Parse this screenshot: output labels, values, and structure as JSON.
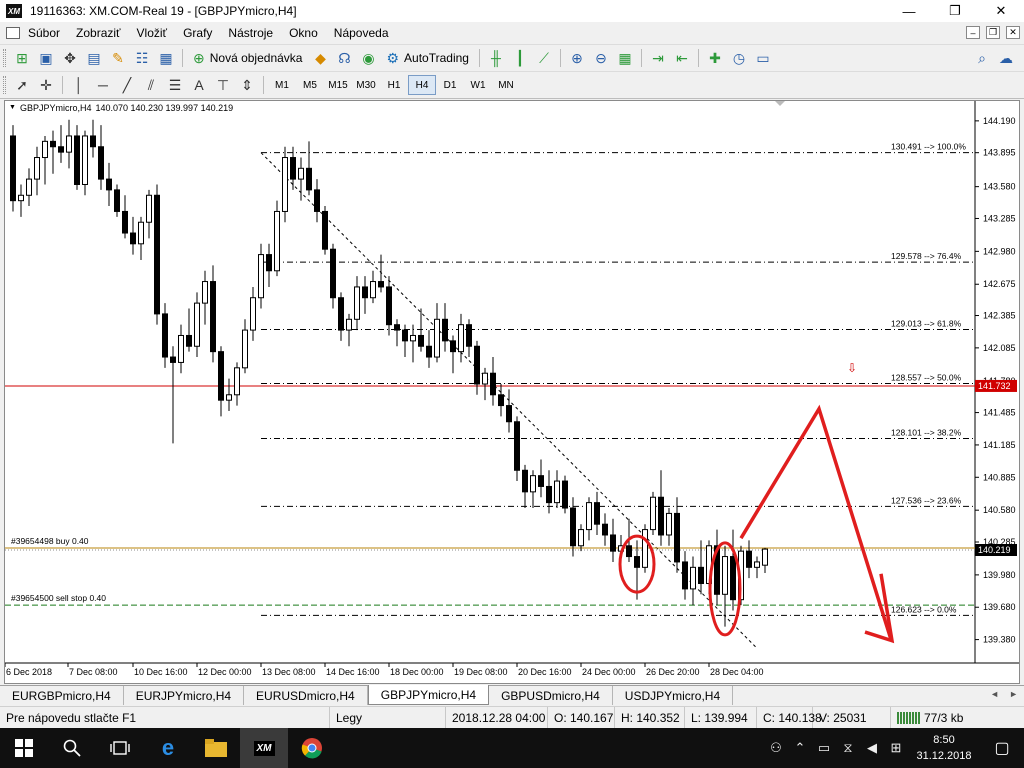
{
  "window": {
    "title": "19116363: XM.COM-Real 19 - [GBPJPYmicro,H4]",
    "app_icon_text": "XM",
    "minimize": "—",
    "maximize": "❐",
    "close": "✕"
  },
  "menu": {
    "items": [
      "Súbor",
      "Zobraziť",
      "Vložiť",
      "Grafy",
      "Nástroje",
      "Okno",
      "Nápoveda"
    ],
    "mdi_minimize": "–",
    "mdi_restore": "❐",
    "mdi_close": "✕"
  },
  "toolbar": {
    "new_order_label": "Nová objednávka",
    "autotrading_label": "AutoTrading"
  },
  "timeframes": [
    "M1",
    "M5",
    "M15",
    "M30",
    "H1",
    "H4",
    "D1",
    "W1",
    "MN"
  ],
  "active_timeframe": "H4",
  "chart": {
    "header_symbol": "GBPJPYmicro,H4",
    "header_ohlc": "140.070 140.230 139.997 140.219",
    "current_price": "140.219",
    "hline_price_tag": "141.732",
    "buy_order_label": "#39654498 buy 0.40",
    "sell_stop_label": "#39654500 sell stop 0.40",
    "colors": {
      "buy_line": "#b8860b",
      "sell_line": "#1a7a1a",
      "red_line": "#d00000",
      "annotation": "#e01e1e",
      "candle": "#000000"
    }
  },
  "chart_data": {
    "type": "candlestick",
    "title": "GBPJPYmicro,H4",
    "ylim": [
      139.2,
      144.3
    ],
    "y_ticks": [
      "144.190",
      "143.895",
      "143.580",
      "143.285",
      "142.980",
      "142.675",
      "142.385",
      "142.085",
      "141.780",
      "141.485",
      "141.185",
      "140.885",
      "140.580",
      "140.285",
      "139.980",
      "139.680",
      "139.380"
    ],
    "x_ticks": [
      "6 Dec 2018",
      "7 Dec 08:00",
      "10 Dec 16:00",
      "12 Dec 00:00",
      "13 Dec 08:00",
      "14 Dec 16:00",
      "18 Dec 00:00",
      "19 Dec 08:00",
      "20 Dec 16:00",
      "24 Dec 00:00",
      "26 Dec 20:00",
      "28 Dec 04:00"
    ],
    "fibonacci": [
      {
        "label": "130.491 --> 100.0%",
        "y": 143.895
      },
      {
        "label": "129.578 --> 76.4%",
        "y": 142.88
      },
      {
        "label": "129.013 --> 61.8%",
        "y": 142.255
      },
      {
        "label": "128.557 --> 50.0%",
        "y": 141.755
      },
      {
        "label": "128.101 --> 38.2%",
        "y": 141.245
      },
      {
        "label": "127.536 --> 23.6%",
        "y": 140.615
      },
      {
        "label": "126.623 --> 0.0%",
        "y": 139.605
      }
    ],
    "hline_price": 141.732,
    "buy_level": 140.22,
    "sell_stop_level": 139.7,
    "current_level": 140.219,
    "ohlc": [
      [
        144.05,
        144.15,
        143.35,
        143.45
      ],
      [
        143.45,
        143.6,
        143.3,
        143.5
      ],
      [
        143.5,
        143.75,
        143.4,
        143.65
      ],
      [
        143.65,
        143.95,
        143.5,
        143.85
      ],
      [
        143.85,
        144.05,
        143.6,
        144.0
      ],
      [
        144.0,
        144.1,
        143.7,
        143.95
      ],
      [
        143.95,
        144.15,
        143.8,
        143.9
      ],
      [
        143.9,
        144.2,
        143.75,
        144.05
      ],
      [
        144.05,
        144.15,
        143.55,
        143.6
      ],
      [
        143.6,
        144.1,
        143.5,
        144.05
      ],
      [
        144.05,
        144.2,
        143.85,
        143.95
      ],
      [
        143.95,
        144.15,
        143.55,
        143.65
      ],
      [
        143.65,
        143.8,
        143.4,
        143.55
      ],
      [
        143.55,
        143.6,
        143.3,
        143.35
      ],
      [
        143.35,
        143.5,
        143.1,
        143.15
      ],
      [
        143.15,
        143.3,
        142.95,
        143.05
      ],
      [
        143.05,
        143.3,
        142.9,
        143.25
      ],
      [
        143.25,
        143.55,
        143.1,
        143.5
      ],
      [
        143.5,
        143.6,
        142.3,
        142.4
      ],
      [
        142.4,
        142.5,
        141.9,
        142.0
      ],
      [
        142.0,
        142.1,
        141.2,
        141.95
      ],
      [
        141.95,
        142.3,
        141.85,
        142.2
      ],
      [
        142.2,
        142.45,
        142.05,
        142.1
      ],
      [
        142.1,
        142.6,
        142.0,
        142.5
      ],
      [
        142.5,
        142.8,
        142.3,
        142.7
      ],
      [
        142.7,
        142.85,
        141.95,
        142.05
      ],
      [
        142.05,
        142.1,
        141.45,
        141.6
      ],
      [
        141.6,
        141.8,
        141.5,
        141.65
      ],
      [
        141.65,
        141.95,
        141.55,
        141.9
      ],
      [
        141.9,
        142.35,
        141.85,
        142.25
      ],
      [
        142.25,
        142.65,
        142.15,
        142.55
      ],
      [
        142.55,
        143.05,
        142.45,
        142.95
      ],
      [
        142.95,
        143.05,
        142.65,
        142.8
      ],
      [
        142.8,
        143.45,
        142.75,
        143.35
      ],
      [
        143.35,
        143.95,
        143.25,
        143.85
      ],
      [
        143.85,
        143.95,
        143.55,
        143.65
      ],
      [
        143.65,
        143.85,
        143.45,
        143.75
      ],
      [
        143.75,
        144.0,
        143.5,
        143.55
      ],
      [
        143.55,
        143.65,
        143.25,
        143.35
      ],
      [
        143.35,
        143.4,
        142.95,
        143.0
      ],
      [
        143.0,
        143.05,
        142.45,
        142.55
      ],
      [
        142.55,
        142.6,
        142.15,
        142.25
      ],
      [
        142.25,
        142.4,
        142.1,
        142.35
      ],
      [
        142.35,
        142.75,
        142.25,
        142.65
      ],
      [
        142.65,
        142.75,
        142.4,
        142.55
      ],
      [
        142.55,
        142.8,
        142.5,
        142.7
      ],
      [
        142.7,
        142.95,
        142.6,
        142.65
      ],
      [
        142.65,
        142.75,
        142.2,
        142.3
      ],
      [
        142.3,
        142.35,
        142.1,
        142.25
      ],
      [
        142.25,
        142.3,
        142.0,
        142.15
      ],
      [
        142.15,
        142.3,
        141.95,
        142.2
      ],
      [
        142.2,
        142.45,
        142.05,
        142.1
      ],
      [
        142.1,
        142.25,
        141.9,
        142.0
      ],
      [
        142.0,
        142.5,
        141.95,
        142.35
      ],
      [
        142.35,
        142.5,
        142.05,
        142.15
      ],
      [
        142.15,
        142.2,
        141.85,
        142.05
      ],
      [
        142.05,
        142.4,
        141.95,
        142.3
      ],
      [
        142.3,
        142.35,
        142.0,
        142.1
      ],
      [
        142.1,
        142.15,
        141.65,
        141.75
      ],
      [
        141.75,
        141.9,
        141.6,
        141.85
      ],
      [
        141.85,
        142.0,
        141.55,
        141.65
      ],
      [
        141.65,
        141.75,
        141.45,
        141.55
      ],
      [
        141.55,
        141.7,
        141.3,
        141.4
      ],
      [
        141.4,
        141.45,
        140.85,
        140.95
      ],
      [
        140.95,
        141.0,
        140.6,
        140.75
      ],
      [
        140.75,
        140.95,
        140.6,
        140.9
      ],
      [
        140.9,
        141.05,
        140.7,
        140.8
      ],
      [
        140.8,
        140.95,
        140.55,
        140.65
      ],
      [
        140.65,
        140.95,
        140.6,
        140.85
      ],
      [
        140.85,
        140.9,
        140.55,
        140.6
      ],
      [
        140.6,
        140.7,
        140.15,
        140.25
      ],
      [
        140.25,
        140.45,
        140.2,
        140.4
      ],
      [
        140.4,
        140.7,
        140.3,
        140.65
      ],
      [
        140.65,
        140.75,
        140.35,
        140.45
      ],
      [
        140.45,
        140.55,
        140.25,
        140.35
      ],
      [
        140.35,
        140.5,
        140.1,
        140.2
      ],
      [
        140.2,
        140.35,
        140.05,
        140.25
      ],
      [
        140.25,
        140.5,
        140.1,
        140.15
      ],
      [
        140.15,
        140.3,
        139.75,
        140.05
      ],
      [
        140.05,
        140.45,
        140.0,
        140.4
      ],
      [
        140.4,
        140.75,
        140.35,
        140.7
      ],
      [
        140.7,
        140.95,
        140.25,
        140.35
      ],
      [
        140.35,
        140.6,
        140.25,
        140.55
      ],
      [
        140.55,
        140.7,
        140.0,
        140.1
      ],
      [
        140.1,
        140.2,
        139.75,
        139.85
      ],
      [
        139.85,
        140.15,
        139.7,
        140.05
      ],
      [
        140.05,
        140.3,
        139.8,
        139.9
      ],
      [
        139.9,
        140.3,
        139.8,
        140.25
      ],
      [
        140.25,
        140.4,
        139.7,
        139.8
      ],
      [
        139.8,
        140.25,
        139.5,
        140.15
      ],
      [
        140.15,
        140.4,
        139.65,
        139.75
      ],
      [
        139.75,
        140.25,
        139.7,
        140.2
      ],
      [
        140.2,
        140.3,
        139.95,
        140.05
      ],
      [
        140.05,
        140.15,
        139.95,
        140.1
      ],
      [
        140.07,
        140.23,
        139.997,
        140.219
      ]
    ]
  },
  "tabs": [
    "EURGBPmicro,H4",
    "EURJPYmicro,H4",
    "EURUSDmicro,H4",
    "GBPJPYmicro,H4",
    "GBPUSDmicro,H4",
    "USDJPYmicro,H4"
  ],
  "active_tab": "GBPJPYmicro,H4",
  "status": {
    "help": "Pre nápovedu stlačte F1",
    "profile": "Legy",
    "datetime": "2018.12.28 04:00",
    "open": "O: 140.167",
    "high": "H: 140.352",
    "low": "L: 139.994",
    "close": "C: 140.138",
    "volume": "V: 25031",
    "traffic": "77/3 kb"
  },
  "taskbar": {
    "time": "8:50",
    "date": "31.12.2018"
  }
}
